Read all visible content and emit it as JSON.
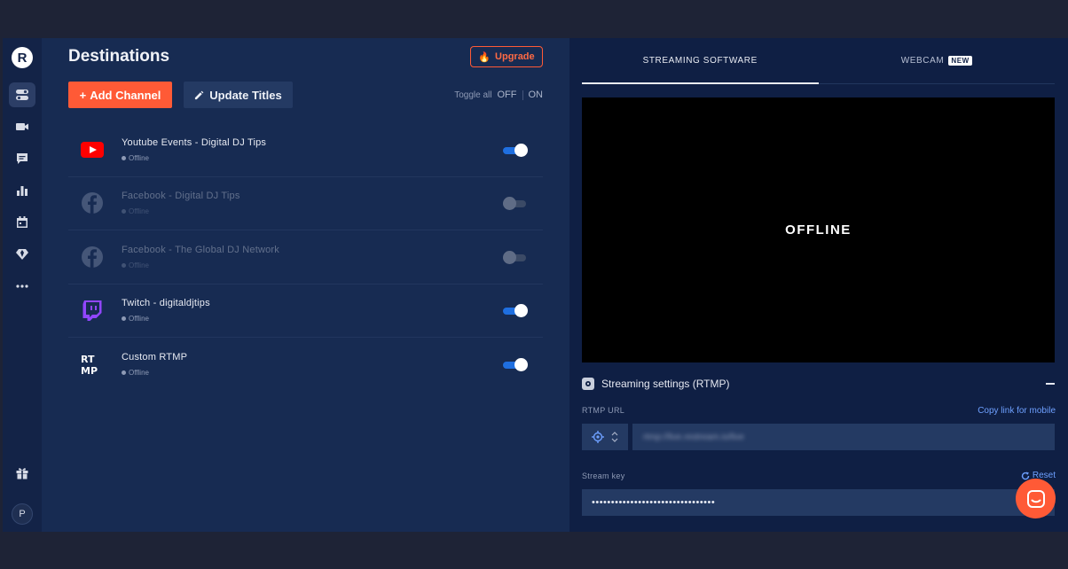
{
  "sidebar": {
    "logo_letter": "R",
    "avatar_letter": "P",
    "icons": [
      "toggles-icon",
      "camera-icon",
      "chat-icon",
      "analytics-icon",
      "calendar-icon",
      "diamond-icon",
      "more-icon"
    ],
    "bottom_icons": [
      "gift-icon"
    ]
  },
  "destinations": {
    "title": "Destinations",
    "upgrade_label": "Upgrade",
    "add_channel_label": "Add Channel",
    "update_titles_label": "Update Titles",
    "toggle_all_label": "Toggle all",
    "toggle_off_label": "OFF",
    "toggle_on_label": "ON",
    "channels": [
      {
        "name": "Youtube Events - Digital DJ Tips",
        "status": "Offline",
        "enabled": true,
        "icon": "youtube-icon"
      },
      {
        "name": "Facebook - Digital DJ Tips",
        "status": "Offline",
        "enabled": false,
        "icon": "facebook-icon"
      },
      {
        "name": "Facebook - The Global DJ Network",
        "status": "Offline",
        "enabled": false,
        "icon": "facebook-icon"
      },
      {
        "name": "Twitch - digitaldjtips",
        "status": "Offline",
        "enabled": true,
        "icon": "twitch-icon"
      },
      {
        "name": "Custom RTMP",
        "status": "Offline",
        "enabled": true,
        "icon": "rtmp-icon"
      }
    ]
  },
  "stream": {
    "tab_software": "STREAMING SOFTWARE",
    "tab_webcam": "WEBCAM",
    "badge_new": "NEW",
    "preview_text": "OFFLINE",
    "settings_title": "Streaming settings (RTMP)",
    "rtmp_url_label": "RTMP URL",
    "copy_link_label": "Copy link for mobile",
    "rtmp_url_value": "rtmp://live.restream.io/live",
    "stream_key_label": "Stream key",
    "reset_label": "Reset",
    "stream_key_value": "••••••••••••••••••••••••••••••••"
  },
  "colors": {
    "accent": "#ff5a36",
    "toggle_on": "#1f6fe0",
    "link": "#6ea0ff",
    "panel_left": "#172b52",
    "panel_right": "#0f1f44"
  }
}
